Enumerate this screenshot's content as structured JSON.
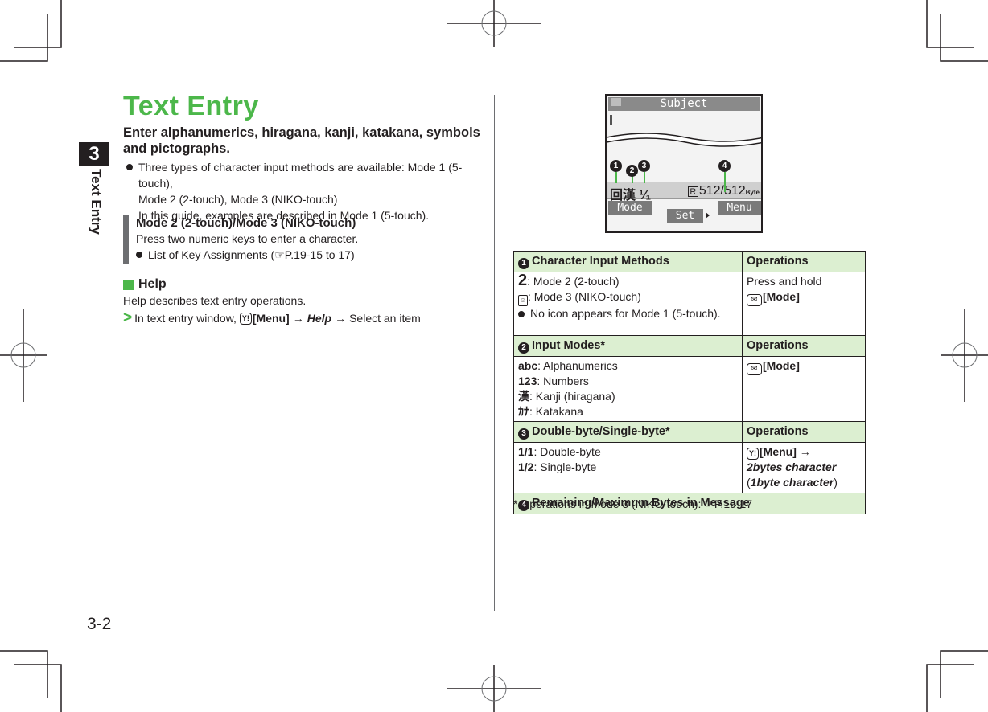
{
  "side_tab": {
    "chapter": "3",
    "label": "Text Entry"
  },
  "page_number": "3-2",
  "left": {
    "title": "Text Entry",
    "lead": "Enter alphanumerics, hiragana, kanji, katakana, symbols and pictographs.",
    "bullet_line1": "Three types of character input methods are available: Mode 1 (5-touch),",
    "bullet_line2": "Mode 2 (2-touch), Mode 3 (NIKO-touch)",
    "bullet_line3": "In this guide, examples are described in Mode 1 (5-touch).",
    "note": {
      "title": "Mode 2 (2-touch)/Mode 3 (NIKO-touch)",
      "text": "Press two numeric keys to enter a character.",
      "bullet_prefix": "List of Key Assignments (",
      "ref_icon": "☞",
      "ref": "P.19-15 to 17)"
    },
    "help": {
      "heading": "Help",
      "desc": "Help describes text entry operations.",
      "step_prefix": "In text entry window,",
      "key_icon": "Y!",
      "menu": "[Menu]",
      "arrow": "→",
      "help_item": "Help",
      "select": "Select an item"
    }
  },
  "screen": {
    "title": "Subject",
    "status_left": "漢 ¹⁄₁",
    "status_mode_icon": "回",
    "status_r": "R",
    "status_bytes": "512/512",
    "status_unit": "Byte",
    "soft_left": "Mode",
    "soft_center": "Set",
    "soft_right": "Menu",
    "callouts": [
      "1",
      "2",
      "3",
      "4"
    ]
  },
  "table": {
    "sections": [
      {
        "num": "1",
        "header": "Character Input Methods",
        "op_header": "Operations",
        "rows": [
          "2",
          ": Mode 2 (2-touch)",
          ": Mode 3 (NIKO-touch)",
          "No icon appears for Mode 1 (5-touch)."
        ],
        "op_line1": "Press and hold",
        "op_key": "[Mode]"
      },
      {
        "num": "2",
        "header": "Input Modes*",
        "op_header": "Operations",
        "items": [
          {
            "k": "abc",
            "v": ": Alphanumerics"
          },
          {
            "k": "123",
            "v": ": Numbers"
          },
          {
            "k": "漢",
            "v": ": Kanji (hiragana)"
          },
          {
            "k": "ｶﾅ",
            "v": ": Katakana"
          }
        ],
        "op_key": "[Mode]"
      },
      {
        "num": "3",
        "header": "Double-byte/Single-byte*",
        "op_header": "Operations",
        "items": [
          {
            "k": "1/1",
            "v": ": Double-byte"
          },
          {
            "k": "1/2",
            "v": ": Single-byte"
          }
        ],
        "op_key": "[Menu] →",
        "op_line2": "2bytes character",
        "op_line3_open": "(",
        "op_line3": "1byte character",
        "op_line3_close": ")"
      },
      {
        "num": "4",
        "header": "Remaining/Maximum Bytes in Message"
      }
    ],
    "footnote": "* Operations in Mode 3 (NIKO-touch): ",
    "footnote_ref": "P.19-17"
  }
}
